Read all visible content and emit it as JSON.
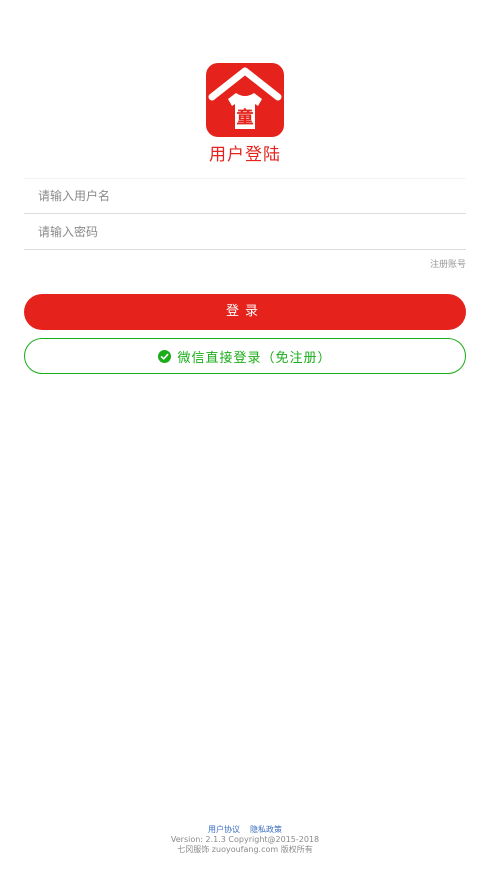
{
  "app": {
    "logo_char": "童",
    "title": "用户登陆",
    "brand_color": "#e5221b",
    "wechat_color": "#1aad19"
  },
  "form": {
    "username_placeholder": "请输入用户名",
    "username_value": "",
    "password_placeholder": "请输入密码",
    "password_value": "",
    "register_label": "注册账号",
    "login_label": "登录",
    "wechat_label": "微信直接登录（免注册）",
    "wechat_icon": "wechat-check-icon"
  },
  "footer": {
    "user_agreement": "用户协议",
    "privacy_policy": "隐私政策",
    "version": "Version: 2.1.3 Copyright@2015-2018",
    "copyright": "七冈服饰 zuoyoufang.com 版权所有"
  }
}
